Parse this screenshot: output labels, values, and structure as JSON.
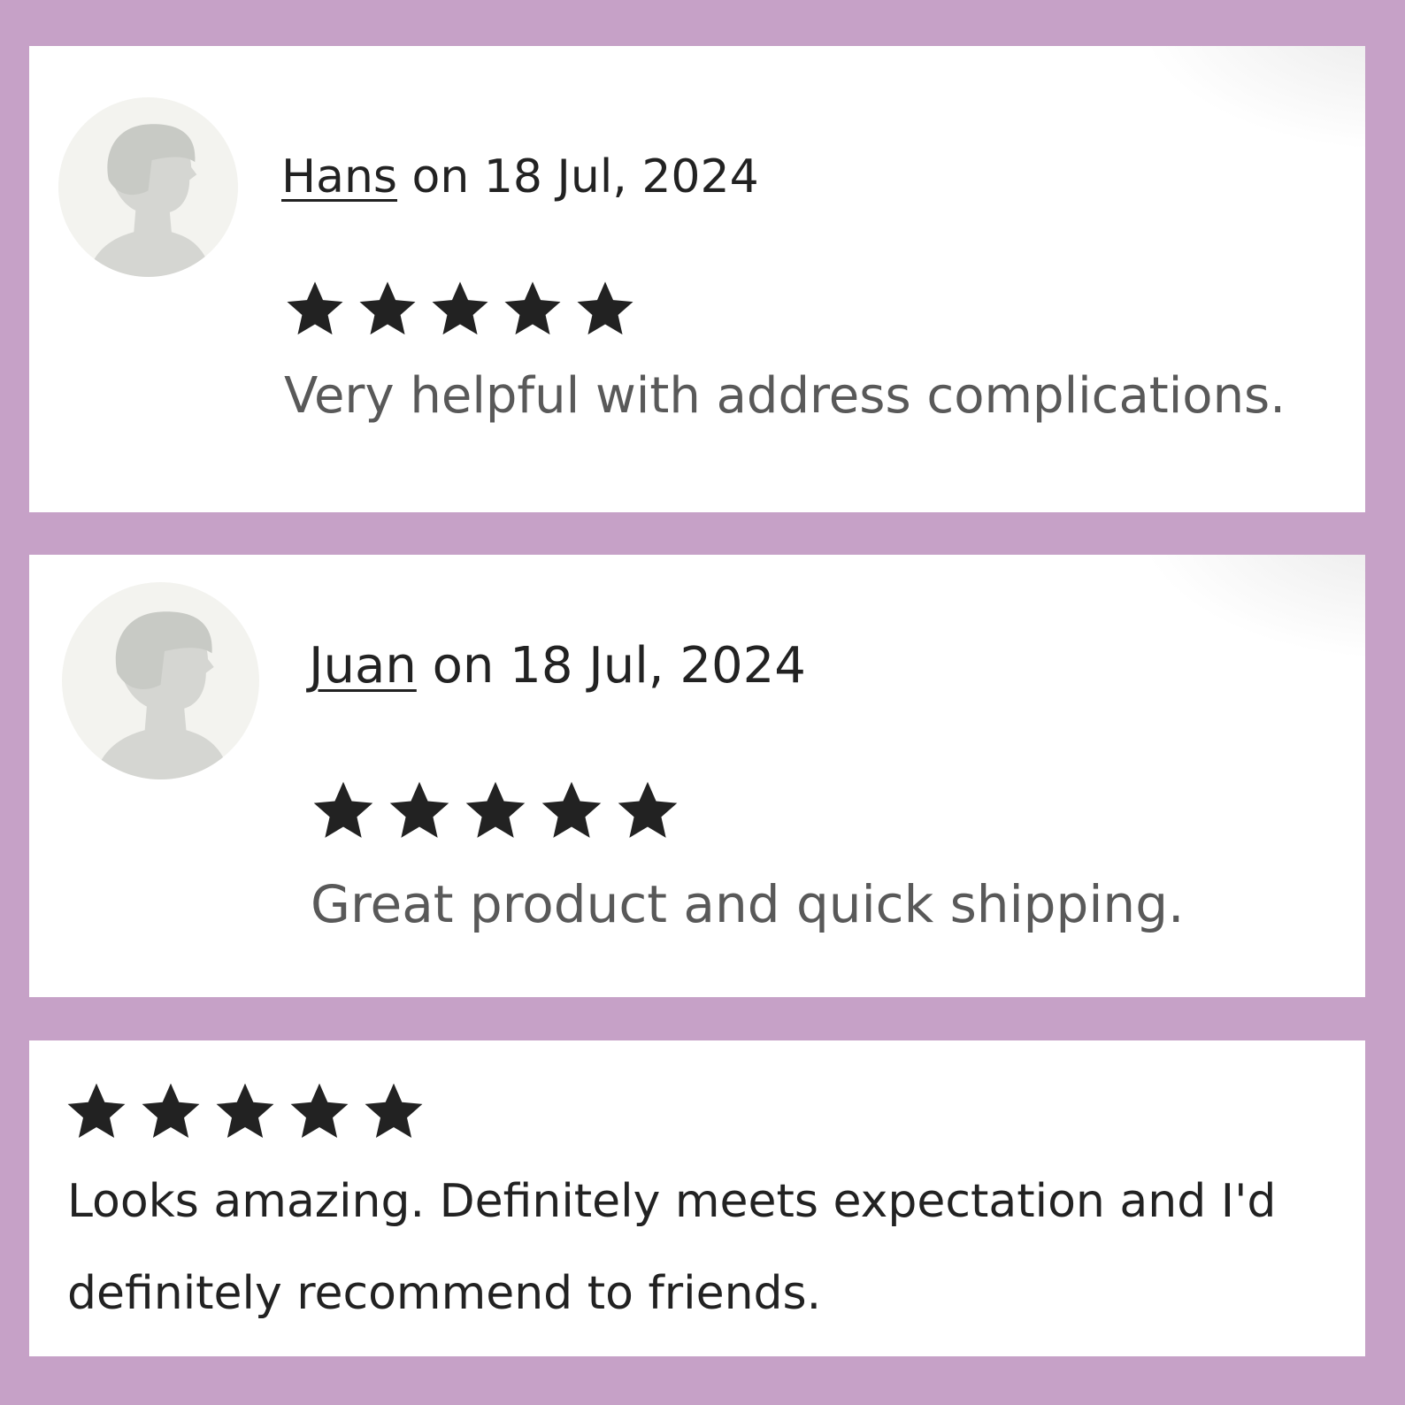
{
  "colors": {
    "background": "#c6a1c7",
    "card": "#ffffff",
    "star": "#222222",
    "text_primary": "#222222",
    "text_secondary": "#595959",
    "avatar_bg": "#f3f3ef",
    "avatar_head": "#c8cac5",
    "avatar_body": "#d5d6d2"
  },
  "reviews": [
    {
      "avatar_icon": "user-avatar-icon",
      "name": "Hans",
      "date_text": " on 18 Jul, 2024",
      "rating": 5,
      "rating_max": 5,
      "text": "Very helpful with address complications."
    },
    {
      "avatar_icon": "user-avatar-icon",
      "name": "Juan",
      "date_text": " on 18 Jul, 2024",
      "rating": 5,
      "rating_max": 5,
      "text": "Great product and quick shipping."
    },
    {
      "rating": 5,
      "rating_max": 5,
      "text": "Looks amazing. Definitely meets expectation and I'd definitely recommend to friends."
    }
  ]
}
